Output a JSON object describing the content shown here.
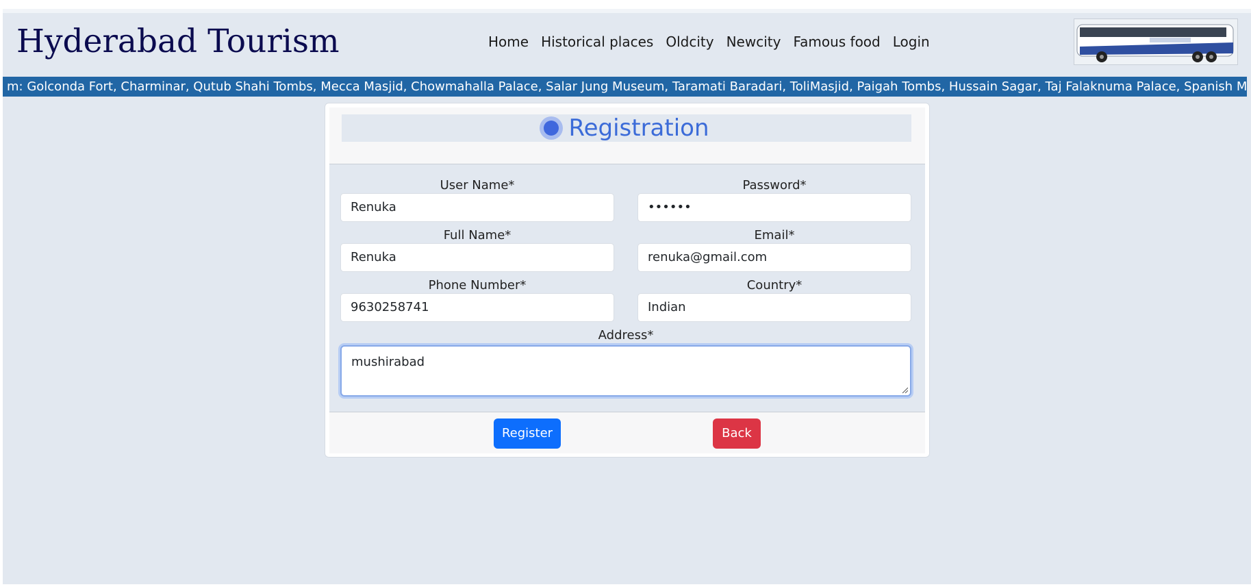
{
  "header": {
    "brand": "Hyderabad Tourism",
    "nav": [
      "Home",
      "Historical places",
      "Oldcity",
      "Newcity",
      "Famous food",
      "Login"
    ],
    "bus_image_icon": "bus-image"
  },
  "marquee": {
    "text": "m: Golconda Fort, Charminar, Qutub Shahi Tombs, Mecca Masjid, Chowmahalla Palace, Salar Jung Museum, Taramati Baradari, ToliMasjid, Paigah Tombs, Hussain Sagar, Taj Falaknuma Palace, Spanish Mosque, High Cour"
  },
  "form": {
    "title": "Registration",
    "fields": {
      "username": {
        "label": "User Name*",
        "value": "Renuka"
      },
      "password": {
        "label": "Password*",
        "value": "••••••"
      },
      "fullname": {
        "label": "Full Name*",
        "value": "Renuka"
      },
      "email": {
        "label": "Email*",
        "value": "renuka@gmail.com"
      },
      "phone": {
        "label": "Phone Number*",
        "value": "9630258741"
      },
      "country": {
        "label": "Country*",
        "value": "Indian"
      },
      "address": {
        "label": "Address*",
        "value": "mushirabad"
      }
    },
    "buttons": {
      "register": "Register",
      "back": "Back"
    }
  },
  "colors": {
    "page_bg": "#e2e8f0",
    "marquee_bg": "#2166a5",
    "title": "#3b6bd8",
    "primary": "#0d6efd",
    "danger": "#dc3545"
  }
}
